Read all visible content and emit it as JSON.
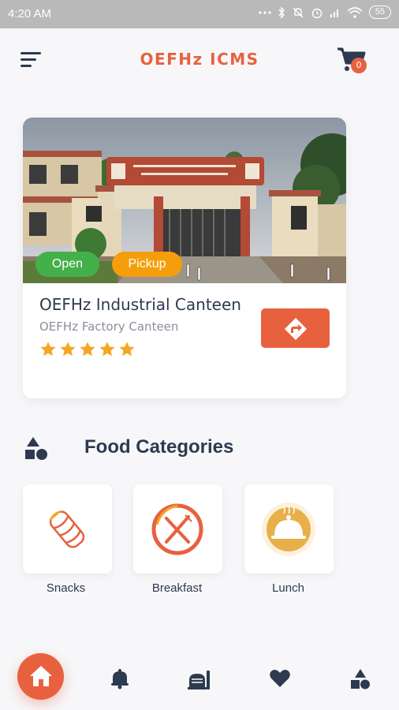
{
  "status_bar": {
    "time": "4:20 AM",
    "battery": "55"
  },
  "header": {
    "title": "OEFHz ICMS",
    "cart_count": "0"
  },
  "canteen": {
    "name": "OEFHz Industrial Canteen",
    "subtitle": "OEFHz Factory Canteen",
    "tags": {
      "open": "Open",
      "pickup": "Pickup"
    },
    "rating": 5,
    "rating_max": 5
  },
  "categories_section": {
    "title": "Food Categories",
    "items": [
      {
        "label": "Snacks",
        "icon": "burrito-icon"
      },
      {
        "label": "Breakfast",
        "icon": "plate-fork-knife-icon"
      },
      {
        "label": "Lunch",
        "icon": "cloche-icon"
      }
    ]
  },
  "bottom_nav": {
    "items": [
      "home-icon",
      "bell-icon",
      "menu-food-icon",
      "heart-icon",
      "categories-icon"
    ]
  },
  "colors": {
    "accent": "#e8613f",
    "open": "#43b04a",
    "pickup": "#f59e0b",
    "star": "#f5a623",
    "text": "#2d3a4f"
  }
}
